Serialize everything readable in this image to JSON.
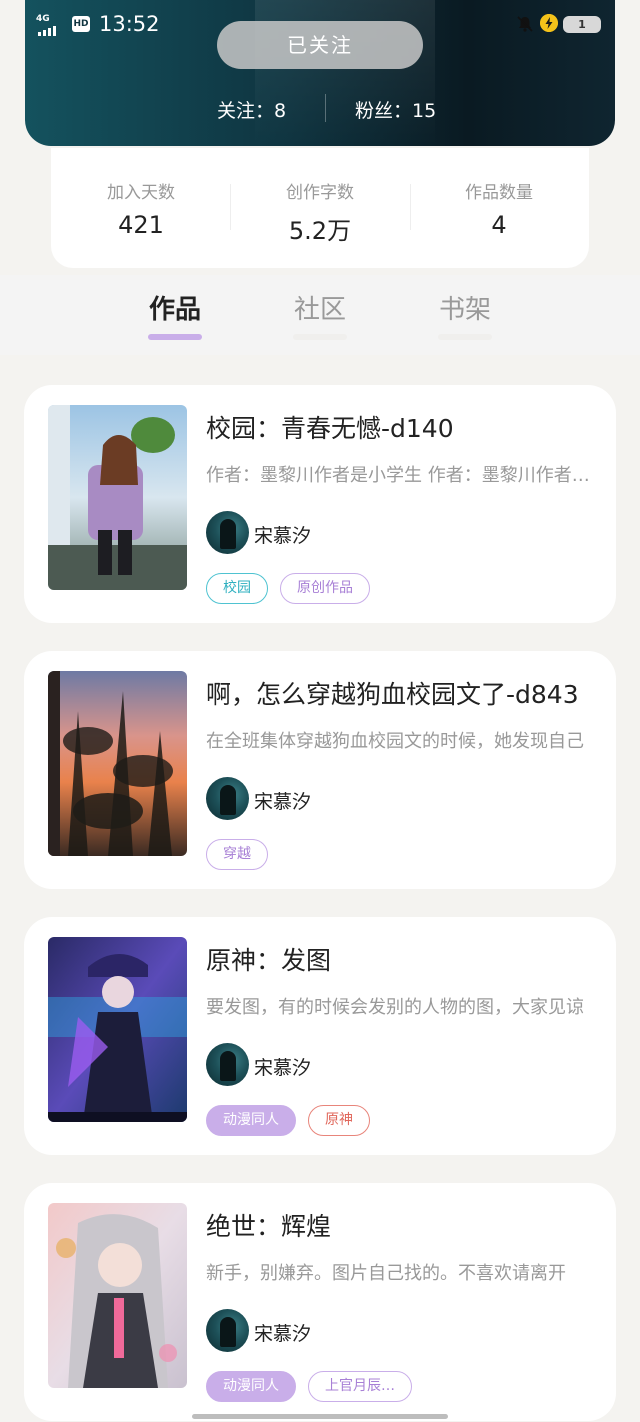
{
  "status_bar": {
    "network": "4G",
    "hd": "HD",
    "time": "13:52",
    "battery": "1",
    "icons": [
      "signal-icon",
      "hd-icon",
      "mute-bell-icon",
      "charging-icon",
      "battery-icon"
    ]
  },
  "profile": {
    "follow_button": "已关注",
    "following": "关注：8",
    "followers": "粉丝：15"
  },
  "stats": [
    {
      "label": "加入天数",
      "value": "421"
    },
    {
      "label": "创作字数",
      "value": "5.2万"
    },
    {
      "label": "作品数量",
      "value": "4"
    }
  ],
  "tabs": [
    {
      "label": "作品",
      "active": true
    },
    {
      "label": "社区",
      "active": false
    },
    {
      "label": "书架",
      "active": false
    }
  ],
  "works": [
    {
      "title": "校园：青春无憾-d140",
      "desc": "作者：墨黎川作者是小学生  作者：墨黎川作者是小学生",
      "author": "宋慕汐",
      "tags": [
        {
          "label": "校园",
          "style": "teal"
        },
        {
          "label": "原创作品",
          "style": "purple"
        }
      ]
    },
    {
      "title": "啊，怎么穿越狗血校园文了-d843",
      "desc": "在全班集体穿越狗血校园文的时候，她发现自己",
      "author": "宋慕汐",
      "tags": [
        {
          "label": "穿越",
          "style": "purple"
        }
      ]
    },
    {
      "title": "原神：发图",
      "desc": "要发图，有的时候会发别的人物的图，大家见谅",
      "author": "宋慕汐",
      "tags": [
        {
          "label": "动漫同人",
          "style": "filled"
        },
        {
          "label": "原神",
          "style": "red"
        }
      ]
    },
    {
      "title": "绝世：辉煌",
      "desc": "新手，别嫌弃。图片自己找的。不喜欢请离开",
      "author": "宋慕汐",
      "tags": [
        {
          "label": "动漫同人",
          "style": "filled"
        },
        {
          "label": "上官月辰…",
          "style": "purple"
        }
      ]
    }
  ],
  "colors": {
    "accent": "#c9aee9",
    "header_dark": "#0f3440",
    "tag_teal": "#4fc3d1",
    "tag_red": "#e8857b"
  }
}
